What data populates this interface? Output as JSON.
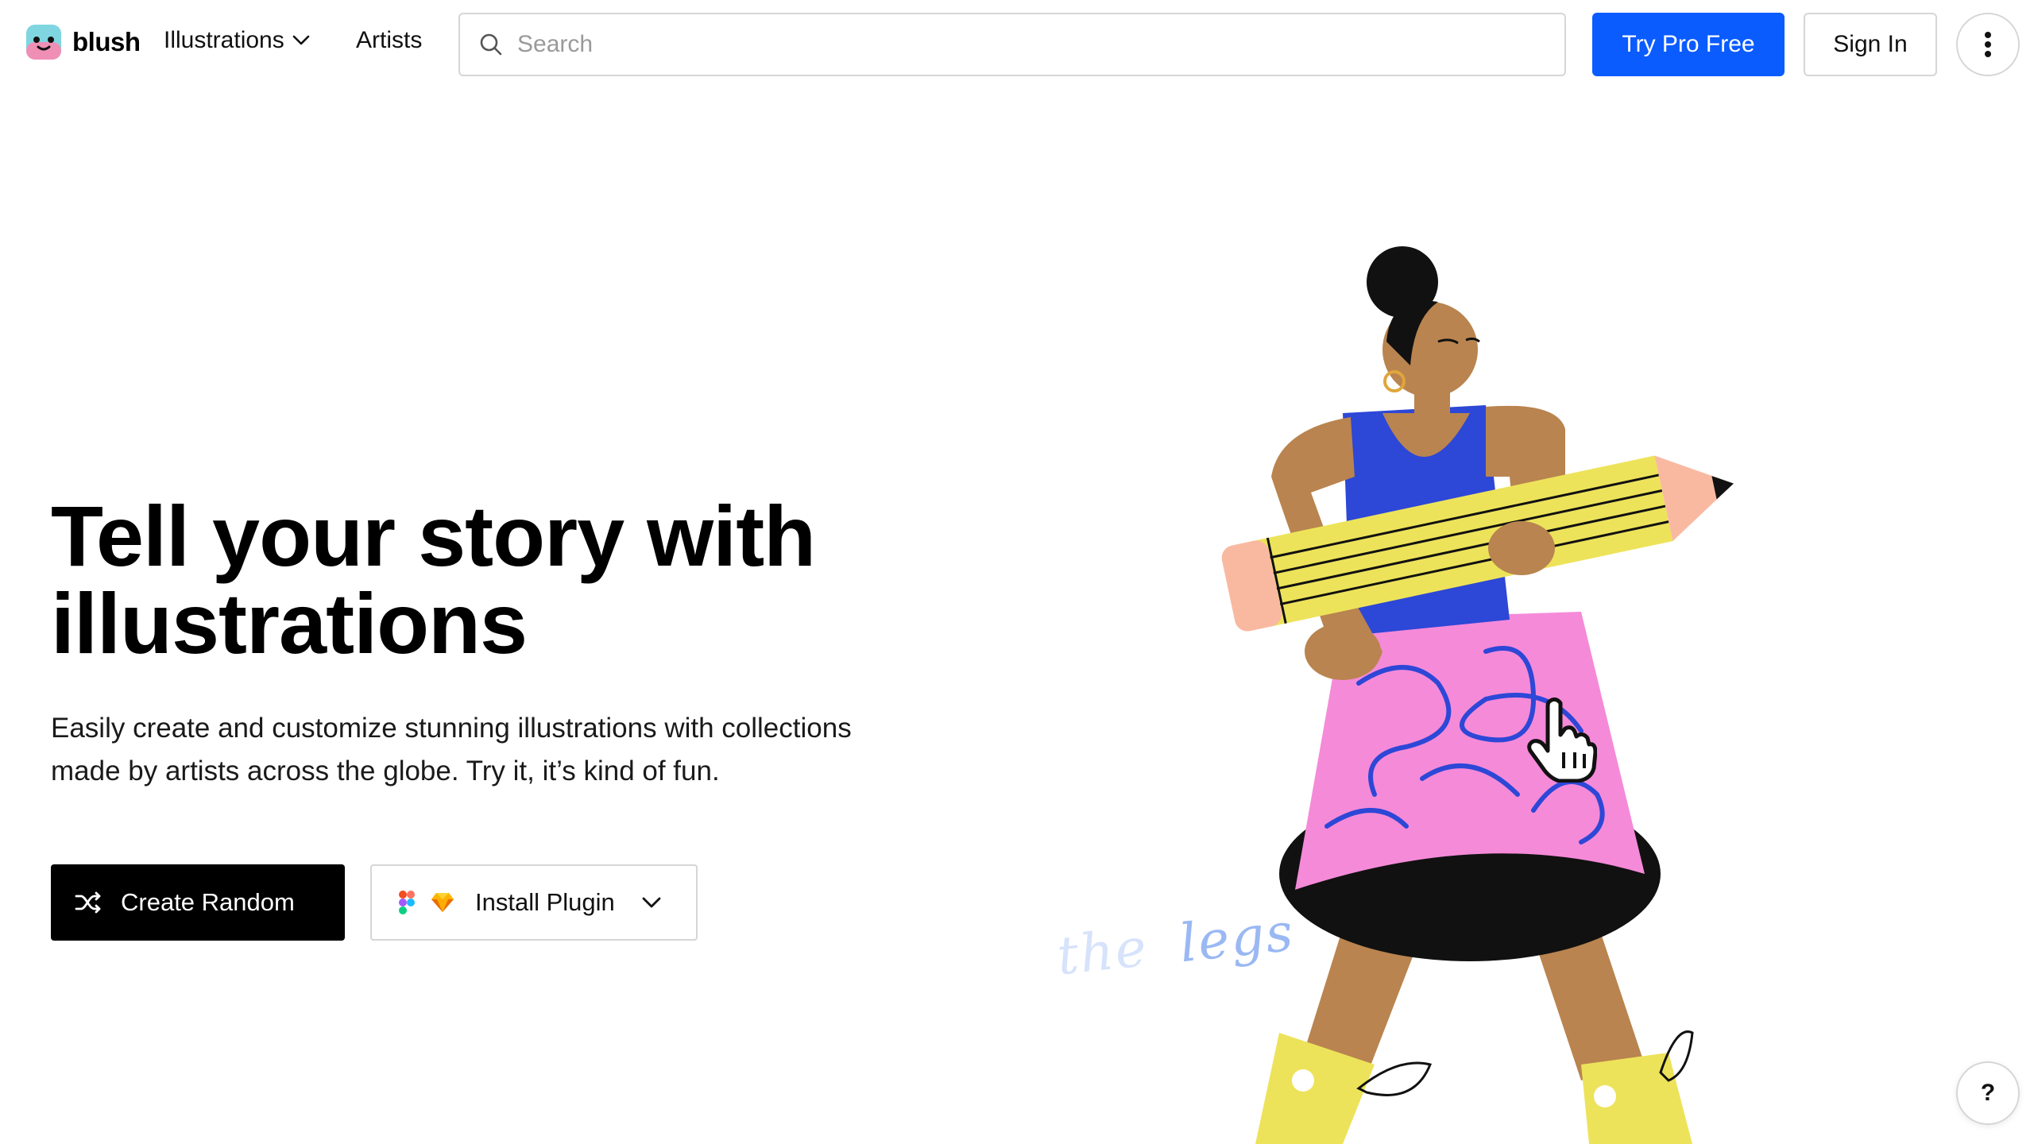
{
  "header": {
    "logo_text": "blush",
    "nav": {
      "illustrations_label": "Illustrations",
      "artists_label": "Artists"
    },
    "search": {
      "placeholder": "Search",
      "value": ""
    },
    "try_pro_label": "Try Pro Free",
    "sign_in_label": "Sign In",
    "icons": {
      "search": "search-icon",
      "more": "more-vertical-icon",
      "dropdown": "chevron-down-icon"
    }
  },
  "hero": {
    "title": "Tell your story with illustrations",
    "description": "Easily create and customize stunning illustrations with collections made by artists across the globe. Try it, it’s kind of fun.",
    "create_random_label": "Create Random",
    "install_plugin_label": "Install Plugin",
    "icons": {
      "shuffle": "shuffle-icon",
      "figma": "figma-icon",
      "sketch": "sketch-icon",
      "dropdown": "chevron-down-icon"
    }
  },
  "illustration": {
    "annotation_the": "the",
    "annotation_legs": "legs"
  },
  "help_label": "?",
  "colors": {
    "primary_blue": "#0a5cff",
    "text": "#000000",
    "border": "#d6d6d6",
    "skirt_pink": "#f58ad9",
    "pencil_yellow": "#ede35a",
    "top_blue": "#2d47d6",
    "skin": "#b9844f"
  }
}
